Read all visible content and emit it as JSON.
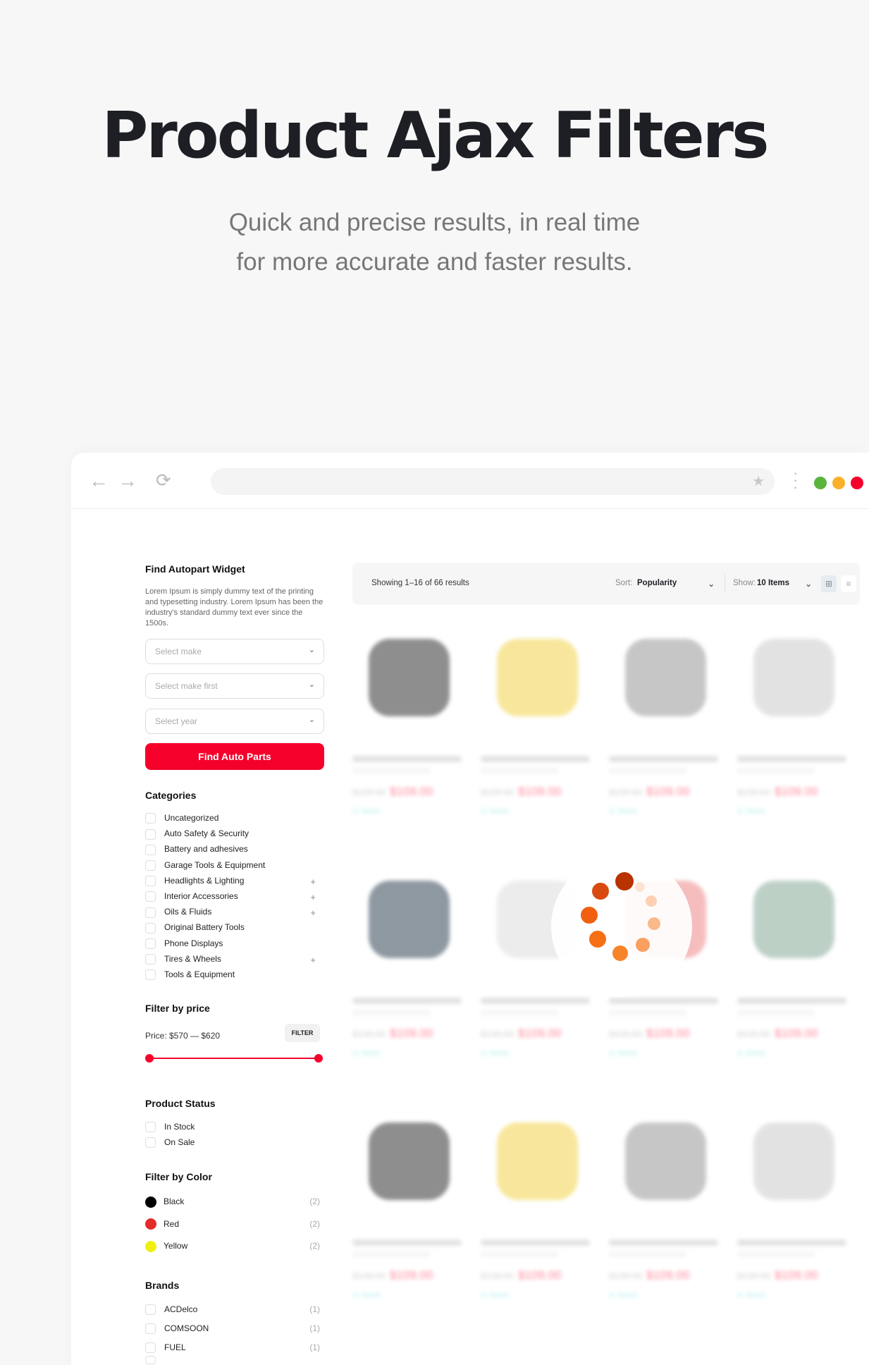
{
  "hero": {
    "title": "Product Ajax Filters",
    "subtitle_line1": "Quick and precise results, in real time",
    "subtitle_line2": "for more accurate and faster results."
  },
  "browser": {
    "back_icon": "arrow-left",
    "forward_icon": "arrow-right",
    "reload_icon": "reload",
    "bookmark_icon": "star",
    "menu_icon": "kebab",
    "dots": [
      "#5ab43c",
      "#f9b12a",
      "#f5002b"
    ]
  },
  "widget": {
    "title": "Find Autopart Widget",
    "description": "Lorem Ipsum is simply dummy text of the printing and typesetting industry. Lorem Ipsum has been the industry's standard dummy text ever since the 1500s.",
    "selects": [
      "Select make",
      "Select make first",
      "Select year"
    ],
    "button": "Find Auto Parts",
    "accent": "#f5002b"
  },
  "categories": {
    "title": "Categories",
    "items": [
      {
        "label": "Uncategorized",
        "plus": ""
      },
      {
        "label": "Auto Safety & Security",
        "plus": ""
      },
      {
        "label": "Battery and adhesives",
        "plus": ""
      },
      {
        "label": "Garage Tools & Equipment",
        "plus": ""
      },
      {
        "label": "Headlights & Lighting",
        "plus": "+"
      },
      {
        "label": "Interior Accessories",
        "plus": "+"
      },
      {
        "label": "Oils & Fluids",
        "plus": "+"
      },
      {
        "label": "Original Battery Tools",
        "plus": ""
      },
      {
        "label": "Phone Displays",
        "plus": ""
      },
      {
        "label": "Tires & Wheels",
        "plus": "+"
      },
      {
        "label": "Tools & Equipment",
        "plus": ""
      }
    ]
  },
  "price": {
    "title": "Filter by price",
    "label": "Price: $570 — $620",
    "button": "FILTER"
  },
  "status": {
    "title": "Product Status",
    "items": [
      "In Stock",
      "On Sale"
    ]
  },
  "colors": {
    "title": "Filter by Color",
    "items": [
      {
        "label": "Black",
        "count": "(2)",
        "color": "#000000"
      },
      {
        "label": "Red",
        "count": "(2)",
        "color": "#e52a2a"
      },
      {
        "label": "Yellow",
        "count": "(2)",
        "color": "#eef010"
      }
    ]
  },
  "brands": {
    "title": "Brands",
    "items": [
      {
        "label": "ACDelco",
        "count": "(1)"
      },
      {
        "label": "COMSOON",
        "count": "(1)"
      },
      {
        "label": "FUEL",
        "count": "(1)"
      }
    ]
  },
  "toolbar": {
    "results": "Showing 1–16 of 66 results",
    "sort_label": "Sort:",
    "sort_value": "Popularity",
    "show_label": "Show:",
    "show_value": "10 Items",
    "grid_icon": "grid",
    "list_icon": "list"
  },
  "products": {
    "old_price": "$139.00",
    "price": "$109.00",
    "stock": "In Stock"
  }
}
